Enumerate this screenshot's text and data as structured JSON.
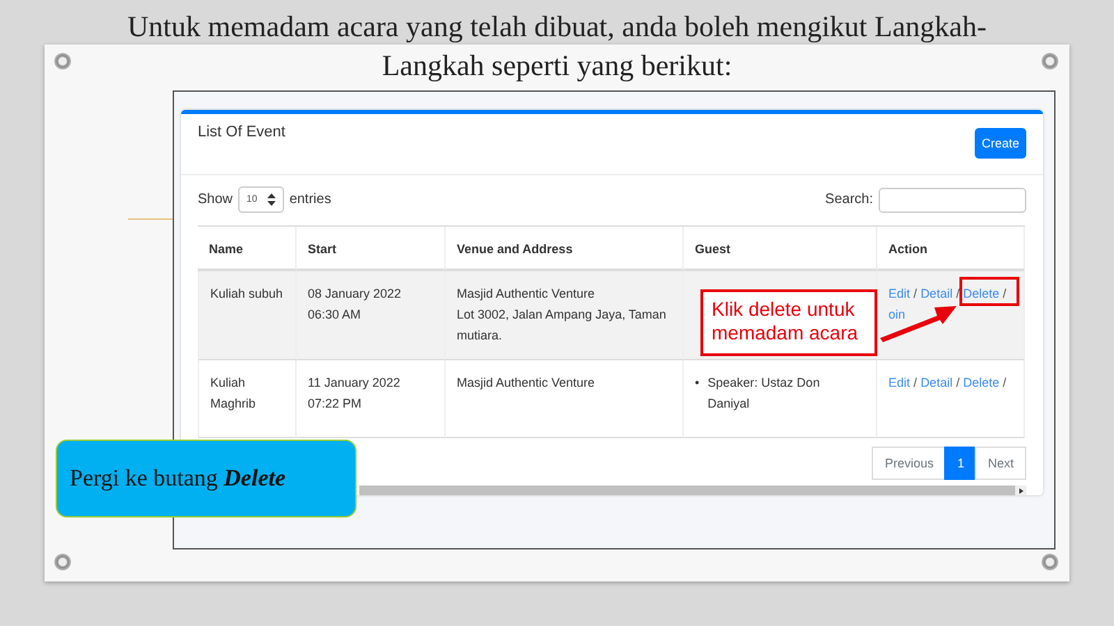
{
  "slide": {
    "title": "Untuk memadam acara yang telah dibuat, anda boleh mengikut Langkah-Langkah seperti yang berikut:"
  },
  "card": {
    "title": "List Of Event",
    "create_button": "Create"
  },
  "length": {
    "label_before": "Show",
    "value": "10",
    "label_after": "entries"
  },
  "search": {
    "label": "Search:"
  },
  "table": {
    "columns": [
      "Name",
      "Start",
      "Venue and Address",
      "Guest",
      "Action"
    ],
    "bullet": "•",
    "rows": [
      {
        "name": "Kuliah subuh",
        "start": [
          "08 January 2022",
          "06:30 AM"
        ],
        "venue": [
          "Masjid Authentic Venture",
          "Lot 3002, Jalan Ampang Jaya, Taman mutiara."
        ],
        "guests": [],
        "actions": [
          {
            "kind": "link",
            "label": "Edit"
          },
          {
            "kind": "separator",
            "label": "/"
          },
          {
            "kind": "link",
            "label": "Detail"
          },
          {
            "kind": "separator",
            "label": "/"
          },
          {
            "kind": "link",
            "label": "Delete"
          },
          {
            "kind": "separator",
            "label": "/"
          },
          {
            "kind": "link",
            "label": "oin"
          }
        ]
      },
      {
        "name": "Kuliah Maghrib",
        "start": [
          "11 January 2022",
          "07:22 PM"
        ],
        "venue": [
          "Masjid Authentic Venture"
        ],
        "guests": [
          "Speaker: Ustaz Don Daniyal"
        ],
        "actions": [
          {
            "kind": "link",
            "label": "Edit"
          },
          {
            "kind": "separator",
            "label": "/"
          },
          {
            "kind": "link",
            "label": "Detail"
          },
          {
            "kind": "separator",
            "label": "/"
          },
          {
            "kind": "link",
            "label": "Delete"
          },
          {
            "kind": "separator",
            "label": "/"
          }
        ]
      }
    ]
  },
  "pagination": [
    {
      "label": "Previous",
      "selected": false
    },
    {
      "label": "1",
      "selected": true
    },
    {
      "label": "Next",
      "selected": false
    }
  ],
  "annotation": {
    "text": "Klik delete untuk memadam acara"
  },
  "instruction": {
    "text": "Pergi ke butang **Delete**"
  }
}
